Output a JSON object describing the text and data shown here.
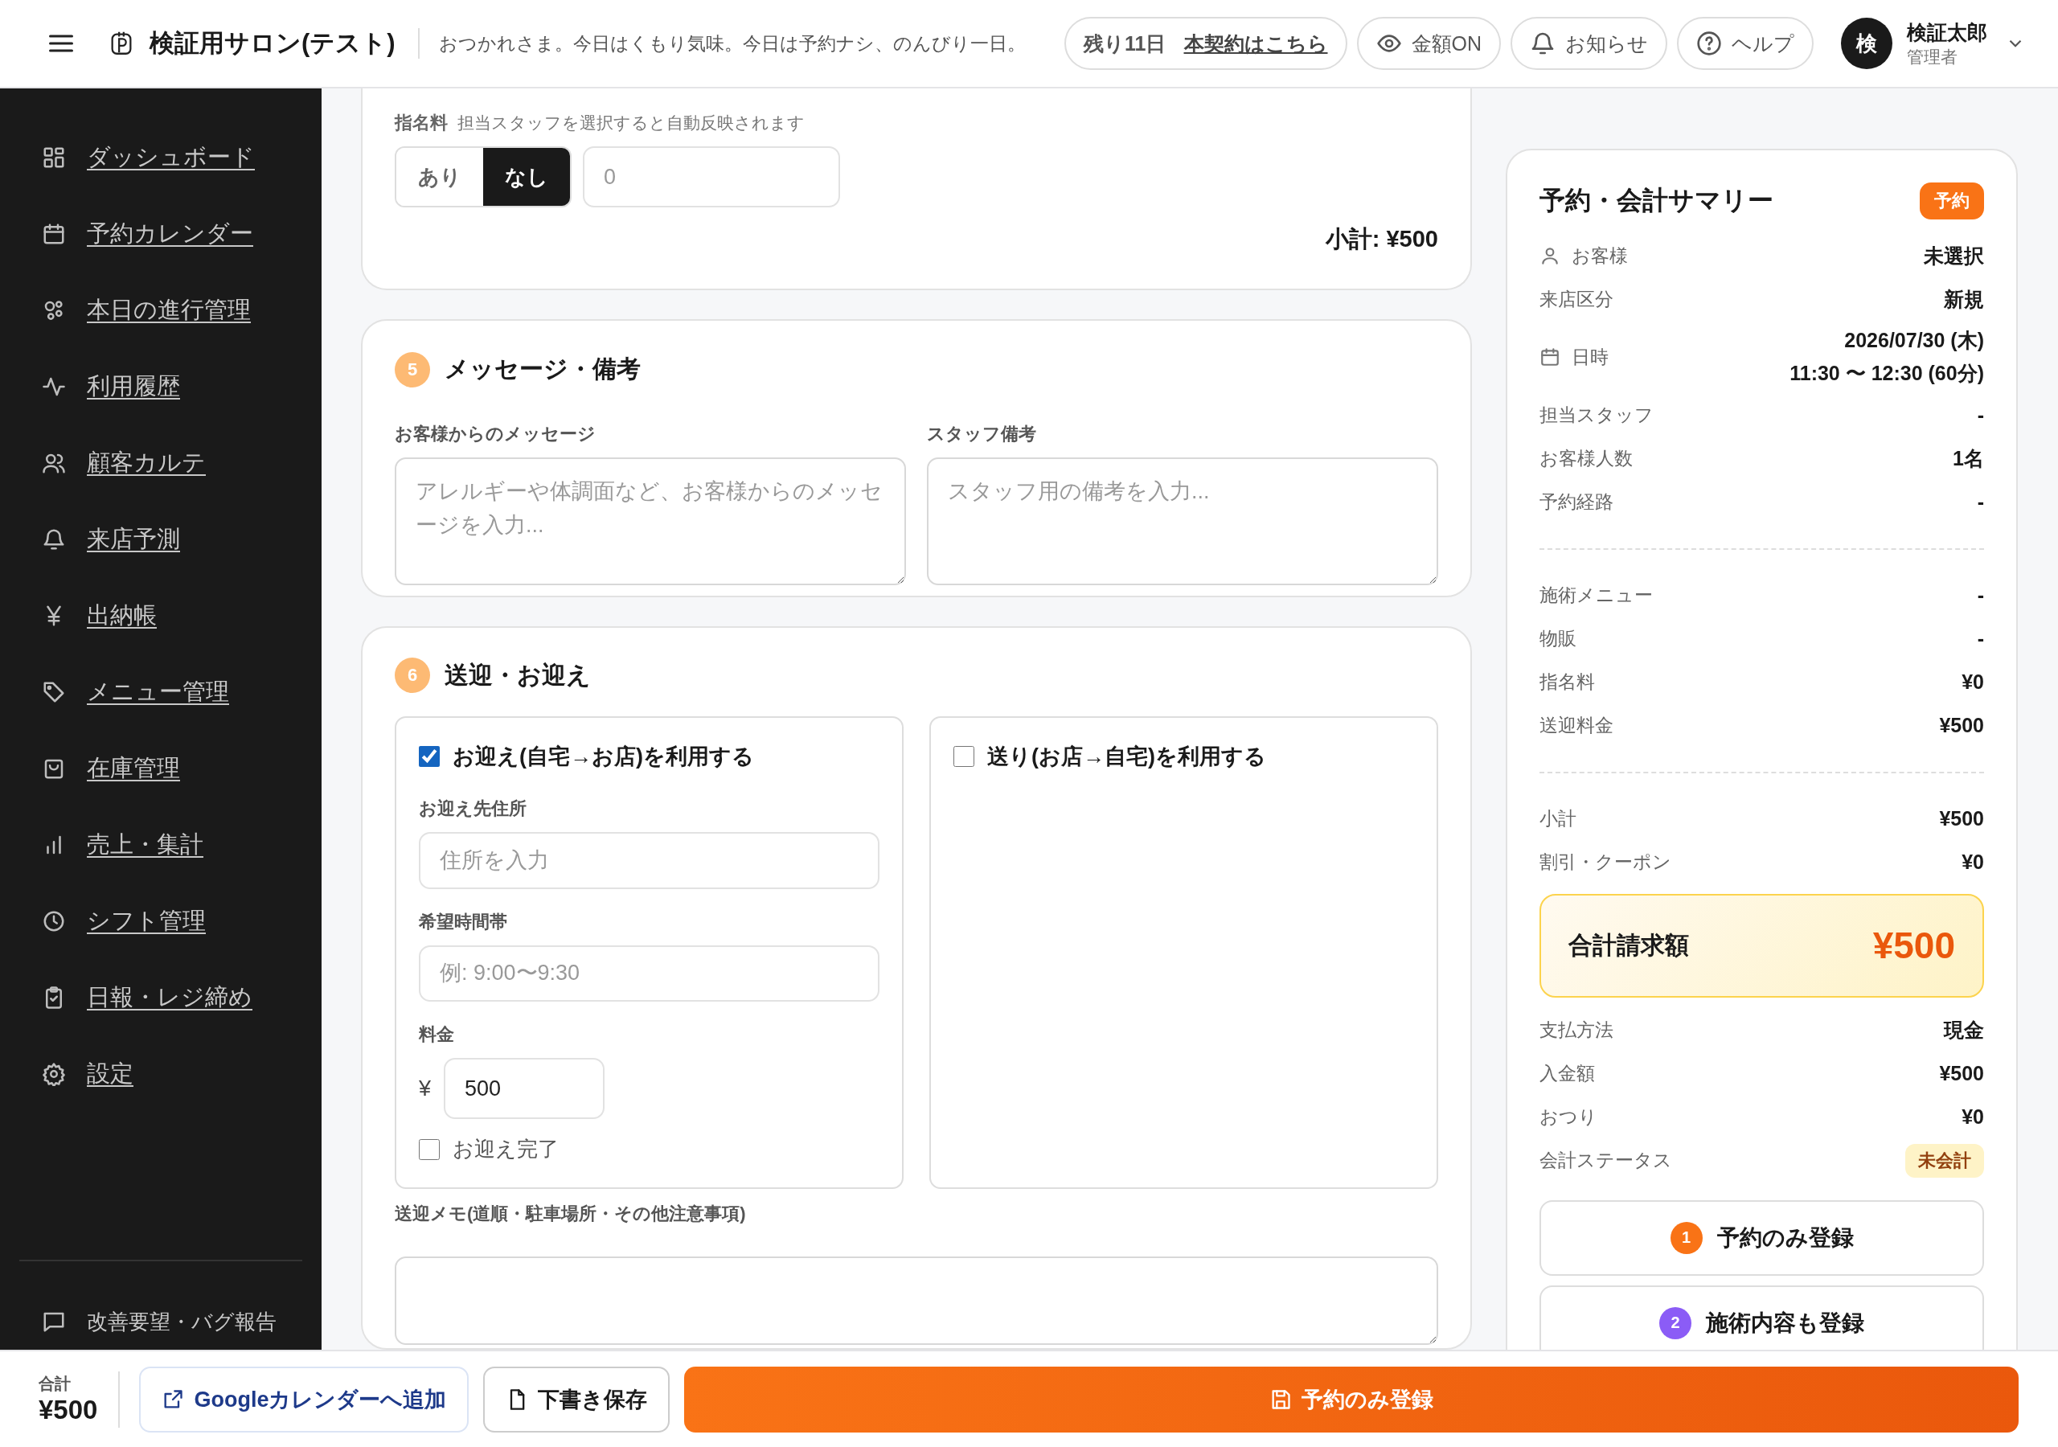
{
  "header": {
    "salon_name": "検証用サロン(テスト)",
    "greeting": "おつかれさま。今日はくもり気味。今日は予約ナシ、のんびり一日。",
    "trial": {
      "days": "残り11日",
      "link": "本契約はこちら"
    },
    "buttons": [
      {
        "kind": "amount",
        "label": "金額ON"
      },
      {
        "kind": "notice",
        "label": "お知らせ"
      },
      {
        "kind": "help",
        "label": "ヘルプ"
      }
    ],
    "user": {
      "initial": "検",
      "name": "検証太郎",
      "role": "管理者"
    }
  },
  "sidebar": {
    "items": [
      {
        "kind": "dashboard",
        "label": "ダッシュボード"
      },
      {
        "kind": "calendar",
        "label": "予約カレンダー"
      },
      {
        "kind": "progress",
        "label": "本日の進行管理"
      },
      {
        "kind": "history",
        "label": "利用履歴"
      },
      {
        "kind": "customers",
        "label": "顧客カルテ"
      },
      {
        "kind": "forecast",
        "label": "来店予測"
      },
      {
        "kind": "ledger",
        "label": "出納帳"
      },
      {
        "kind": "menu",
        "label": "メニュー管理"
      },
      {
        "kind": "stock",
        "label": "在庫管理"
      },
      {
        "kind": "sales",
        "label": "売上・集計"
      },
      {
        "kind": "shift",
        "label": "シフト管理"
      },
      {
        "kind": "report",
        "label": "日報・レジ締め"
      },
      {
        "kind": "settings",
        "label": "設定"
      }
    ],
    "feedback": "改善要望・バグ報告"
  },
  "nomination": {
    "label": "指名料",
    "hint": "担当スタッフを選択すると自動反映されます",
    "options": [
      {
        "label": "あり",
        "selected": false
      },
      {
        "label": "なし",
        "selected": true
      }
    ],
    "amount_placeholder": "0",
    "subtotal": "小計: ¥500"
  },
  "message_section": {
    "number": "5",
    "title": "メッセージ・備考",
    "fields": [
      {
        "label": "お客様からのメッセージ",
        "placeholder": "アレルギーや体調面など、お客様からのメッセージを入力..."
      },
      {
        "label": "スタッフ備考",
        "placeholder": "スタッフ用の備考を入力..."
      }
    ]
  },
  "transfer_section": {
    "number": "6",
    "title": "送迎・お迎え",
    "pickup": {
      "label": "お迎え(自宅→お店)を利用する",
      "checked": true,
      "address_label": "お迎え先住所",
      "address_placeholder": "住所を入力",
      "time_label": "希望時間帯",
      "time_placeholder": "例: 9:00〜9:30",
      "fee_label": "料金",
      "currency": "¥",
      "fee": "500",
      "done": {
        "label": "お迎え完了",
        "checked": false
      }
    },
    "dropoff": {
      "label": "送り(お店→自宅)を利用する",
      "checked": false
    },
    "memo_label": "送迎メモ(道順・駐車場所・その他注意事項)"
  },
  "summary": {
    "title": "予約・会計サマリー",
    "badge": "予約",
    "groups": [
      [
        {
          "kind": "customer",
          "label": "お客様",
          "value": "未選択"
        },
        {
          "label": "来店区分",
          "value": "新規"
        },
        {
          "kind": "datetime",
          "label": "日時",
          "value": "2026/07/30 (木)",
          "value2": "11:30 〜 12:30 (60分)"
        },
        {
          "label": "担当スタッフ",
          "value": "-"
        },
        {
          "label": "お客様人数",
          "value": "1名"
        },
        {
          "label": "予約経路",
          "value": "-"
        }
      ],
      [
        {
          "label": "施術メニュー",
          "value": "-"
        },
        {
          "label": "物販",
          "value": "-"
        },
        {
          "label": "指名料",
          "value": "¥0"
        },
        {
          "label": "送迎料金",
          "value": "¥500"
        }
      ],
      [
        {
          "label": "小計",
          "value": "¥500"
        },
        {
          "label": "割引・クーポン",
          "value": "¥0"
        }
      ]
    ],
    "total": {
      "label": "合計請求額",
      "value": "¥500"
    },
    "payment": [
      {
        "label": "支払方法",
        "value": "現金"
      },
      {
        "label": "入金額",
        "value": "¥500"
      },
      {
        "label": "おつり",
        "value": "¥0"
      },
      {
        "label": "会計ステータス",
        "value": "未会計",
        "kind": "status"
      }
    ],
    "actions": [
      {
        "number": "1",
        "label": "予約のみ登録",
        "color": "#f97316"
      },
      {
        "number": "2",
        "label": "施術内容も登録",
        "color": "#8b5cf6"
      }
    ]
  },
  "bottom_bar": {
    "total_label": "合計",
    "total": "¥500",
    "buttons": [
      {
        "kind": "calendar",
        "label": "Googleカレンダーへ追加"
      },
      {
        "kind": "draft",
        "label": "下書き保存"
      },
      {
        "kind": "submit",
        "label": "予約のみ登録"
      }
    ]
  }
}
